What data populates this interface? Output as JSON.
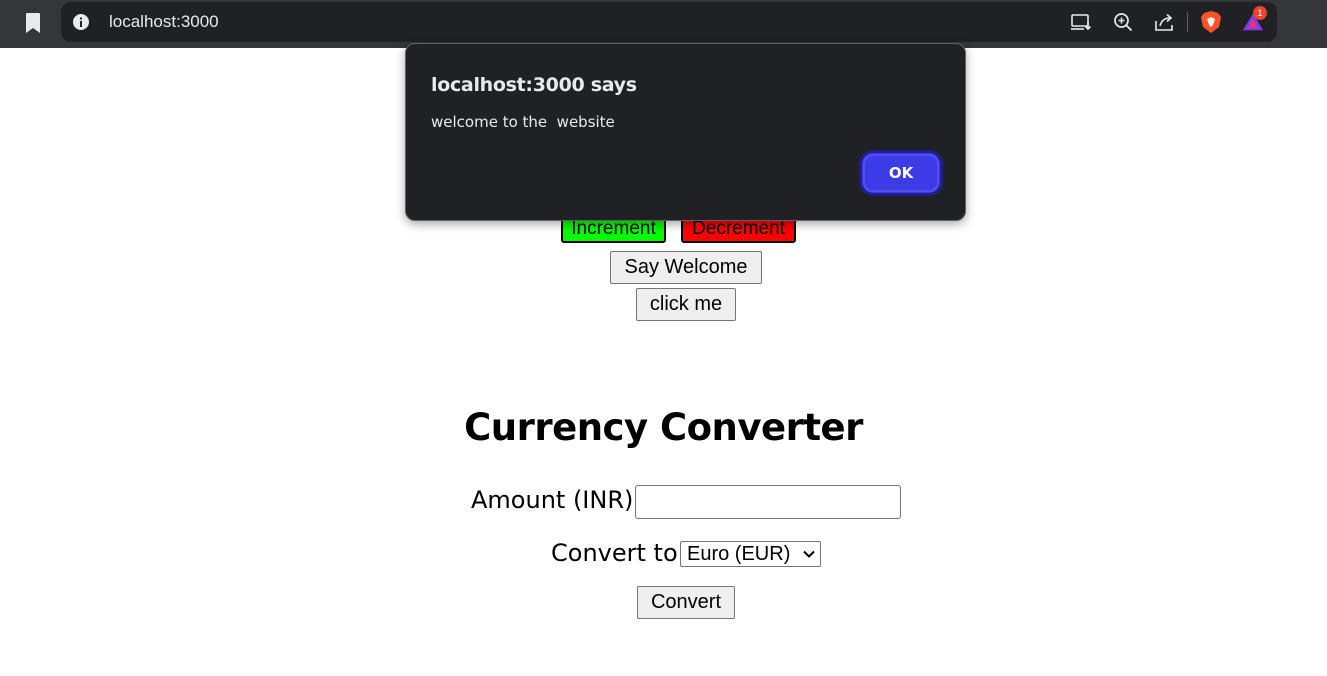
{
  "browser": {
    "url": "localhost:3000",
    "notification_count": "1"
  },
  "page": {
    "increment_label": "Increment",
    "decrement_label": "Decrement",
    "say_welcome_label": "Say Welcome",
    "click_me_label": "click me",
    "currency_title": "Currency Converter",
    "amount_label": "Amount (INR):",
    "amount_value": "",
    "convert_to_label": "Convert to:",
    "selected_currency": "Euro (EUR)",
    "convert_label": "Convert"
  },
  "dialog": {
    "title": "localhost:3000 says",
    "message": "welcome to the  website",
    "ok_label": "OK"
  },
  "colors": {
    "increment_bg": "#00ff00",
    "decrement_bg": "#ff0000",
    "ok_button": "#3c3ce6",
    "dialog_bg": "#202124"
  }
}
